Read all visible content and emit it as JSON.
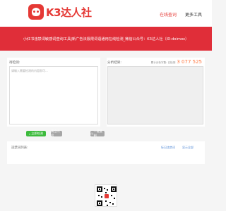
{
  "header": {
    "logo_text": "K3达人社",
    "nav": [
      {
        "label": "在线查词",
        "active": true
      },
      {
        "label": "更多工具",
        "active": false
      }
    ]
  },
  "banner": {
    "text": "小红书违禁词敏感词查询工具|新广告法极限词语通用在线检测_微信公众号：K3达人社（ID:doimox）"
  },
  "input_panel": {
    "title": "待检测:",
    "placeholder": "请输入需要检测的内容即可..."
  },
  "result_panel": {
    "title": "分析结果:",
    "count_label": "累计分析字数: 已检测",
    "count_value": "3 077 525"
  },
  "buttons": {
    "check_label": "立即检测",
    "clear_label": "清空内容",
    "copy_label": "一键复制"
  },
  "bottom": {
    "title": "违禁词列表:",
    "link1": "标记违禁词",
    "link2": "显示全部"
  },
  "colors": {
    "brand": "#e53935",
    "banner": "#e02e39",
    "check_button": "#3dbb3d",
    "count": "#ff7a45"
  },
  "icons": [
    "logo-icon",
    "search-icon",
    "trash-icon",
    "copy-icon",
    "qr-code"
  ]
}
